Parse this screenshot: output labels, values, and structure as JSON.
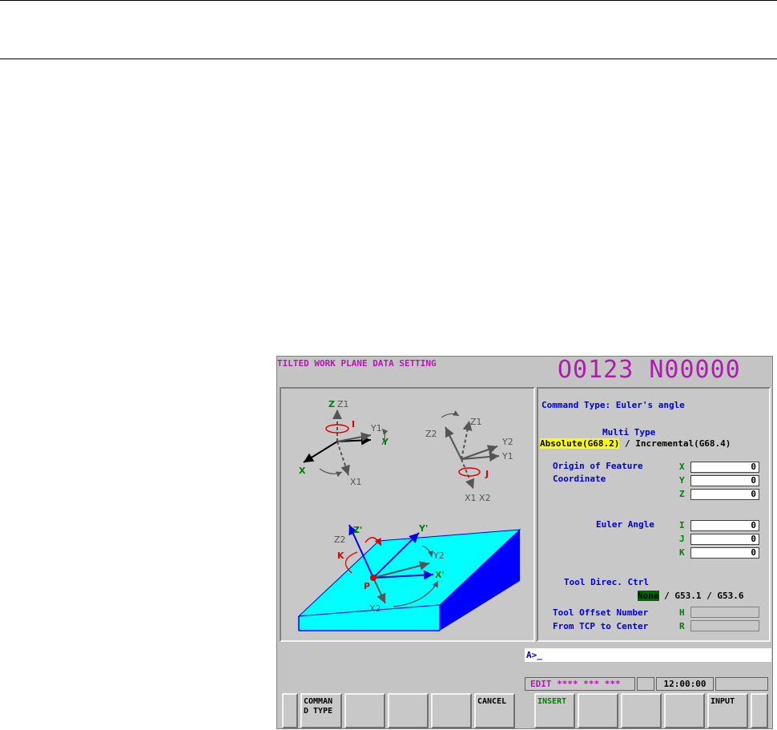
{
  "screen": {
    "title": "TILTED WORK PLANE DATA SETTING",
    "program": "O0123 N00000"
  },
  "diagram": {
    "top_left_labels": [
      "Z",
      "Z1",
      "I",
      "Y1",
      "Y",
      "X",
      "X1"
    ],
    "top_right_labels": [
      "Z1",
      "Z2",
      "Y2",
      "Y1",
      "J",
      "X1 X2"
    ],
    "bottom_labels": [
      "Z2",
      "Z'",
      "Y'",
      "Y2",
      "X'",
      "K",
      "P",
      "X2"
    ]
  },
  "form": {
    "command_type": "Command Type: Euler's angle",
    "multi_type_label": "Multi Type",
    "multi_selected": "Absolute(G68.2)",
    "multi_sep": " / ",
    "multi_other": "Incremental(G68.4)",
    "origin_label_1": "Origin of Feature",
    "origin_label_2": "Coordinate",
    "origin": [
      {
        "axis": "X",
        "value": "0"
      },
      {
        "axis": "Y",
        "value": "0"
      },
      {
        "axis": "Z",
        "value": "0"
      }
    ],
    "euler_label": "Euler Angle",
    "euler": [
      {
        "axis": "I",
        "value": "0"
      },
      {
        "axis": "J",
        "value": "0"
      },
      {
        "axis": "K",
        "value": "0"
      }
    ],
    "tool_dir_label": "Tool Direc. Ctrl",
    "tool_dir_selected": "None",
    "tool_dir_other": " / G53.1 / G53.6",
    "tool_offset_label": "Tool Offset Number",
    "tool_offset_axis": "H",
    "tcp_label": "From TCP to Center",
    "tcp_axis": "R"
  },
  "command_line": "A>_",
  "status": {
    "mode": "EDIT",
    "stars": " **** *** ***",
    "time": "12:00:00"
  },
  "softkeys": [
    "",
    "COMMAN\nD TYPE",
    "",
    "",
    "",
    "CANCEL",
    "INSERT",
    "",
    "",
    "",
    "INPUT",
    ""
  ],
  "colors": {
    "magenta": "#b01cb0",
    "blue": "#0000d0",
    "green": "#008000",
    "highlight_yellow": "#ffff00",
    "selected_green": "#006400",
    "plane_cyan": "#00ffff",
    "plane_blue": "#0000ff"
  }
}
